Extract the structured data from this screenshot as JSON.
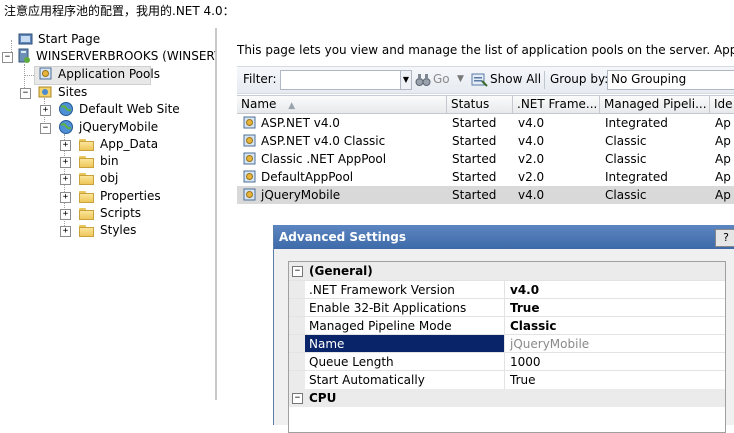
{
  "caption": "注意应用程序池的配置，我用的.NET 4.0：",
  "tree": {
    "start_page": "Start Page",
    "server": "WINSERVERBROOKS (WINSERVER",
    "app_pools": "Application Pools",
    "sites": "Sites",
    "default_site": "Default Web Site",
    "jquery_mobile": "jQueryMobile",
    "folders": [
      "App_Data",
      "bin",
      "obj",
      "Properties",
      "Scripts",
      "Styles"
    ]
  },
  "description": "This page lets you view and manage the list of application pools on the server. Application pools",
  "toolbar": {
    "filter_label": "Filter:",
    "go_label": "Go",
    "show_all_label": "Show All",
    "group_by_label": "Group by:",
    "group_by_value": "No Grouping"
  },
  "grid": {
    "columns": [
      "Name",
      "Status",
      ".NET Frame...",
      "Managed Pipeli...",
      "Ide"
    ],
    "rows": [
      {
        "name": "ASP.NET v4.0",
        "status": "Started",
        "net": "v4.0",
        "pipeline": "Integrated",
        "identity": "Ap"
      },
      {
        "name": "ASP.NET v4.0 Classic",
        "status": "Started",
        "net": "v4.0",
        "pipeline": "Classic",
        "identity": "Ap"
      },
      {
        "name": "Classic .NET AppPool",
        "status": "Started",
        "net": "v2.0",
        "pipeline": "Classic",
        "identity": "Ap"
      },
      {
        "name": "DefaultAppPool",
        "status": "Started",
        "net": "v2.0",
        "pipeline": "Integrated",
        "identity": "Ap"
      },
      {
        "name": "jQueryMobile",
        "status": "Started",
        "net": "v4.0",
        "pipeline": "Classic",
        "identity": "Ap"
      }
    ]
  },
  "dialog": {
    "title": "Advanced Settings",
    "help": "?",
    "category": "(General)",
    "category_next": "CPU",
    "properties": [
      {
        "name": ".NET Framework Version",
        "value": "v4.0"
      },
      {
        "name": "Enable 32-Bit Applications",
        "value": "True"
      },
      {
        "name": "Managed Pipeline Mode",
        "value": "Classic"
      },
      {
        "name": "Name",
        "value": "jQueryMobile"
      },
      {
        "name": "Queue Length",
        "value": "1000"
      },
      {
        "name": "Start Automatically",
        "value": "True"
      }
    ]
  },
  "colors": {
    "dialog_title_bar": "#3d6aa9",
    "selected_property": "#0a246a",
    "selected_row": "#d9d9d9"
  }
}
